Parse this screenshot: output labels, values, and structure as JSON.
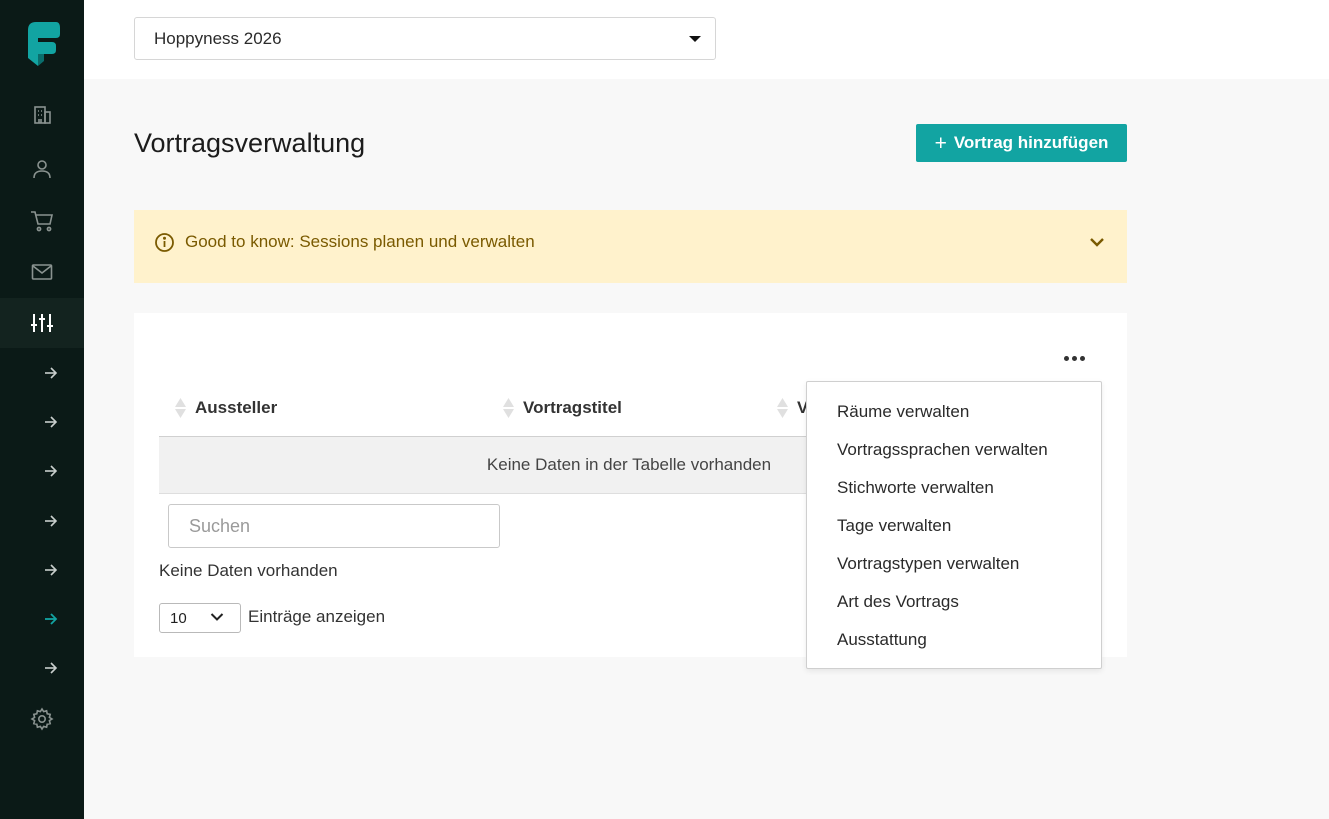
{
  "app": {
    "logo_icon": "brand-f-logo",
    "accent_color": "#12a4a2"
  },
  "sidebar": {
    "icons": [
      "building-icon",
      "user-icon",
      "cart-icon",
      "mail-icon",
      "sliders-icon"
    ],
    "active": "sliders-icon",
    "sub_items": 7,
    "active_sub_index": 5,
    "settings_icon": "gear-icon"
  },
  "topbar": {
    "event_select_value": "Hoppyness 2026"
  },
  "page": {
    "title": "Vortragsverwaltung",
    "add_button_label": "Vortrag hinzufügen"
  },
  "banner": {
    "text": "Good to know: Sessions planen und verwalten",
    "bg_color": "#fff2cc",
    "text_color": "#7a5a00"
  },
  "table": {
    "columns": [
      "Aussteller",
      "Vortragstitel",
      "V"
    ],
    "empty_message": "Keine Daten in der Tabelle vorhanden",
    "search_placeholder": "Suchen",
    "info_text": "Keine Daten vorhanden",
    "page_size": "10",
    "page_size_label": "Einträge anzeigen"
  },
  "menu": {
    "items": [
      "Räume verwalten",
      "Vortragssprachen verwalten",
      "Stichworte verwalten",
      "Tage verwalten",
      "Vortragstypen verwalten",
      "Art des Vortrags",
      "Ausstattung"
    ]
  }
}
